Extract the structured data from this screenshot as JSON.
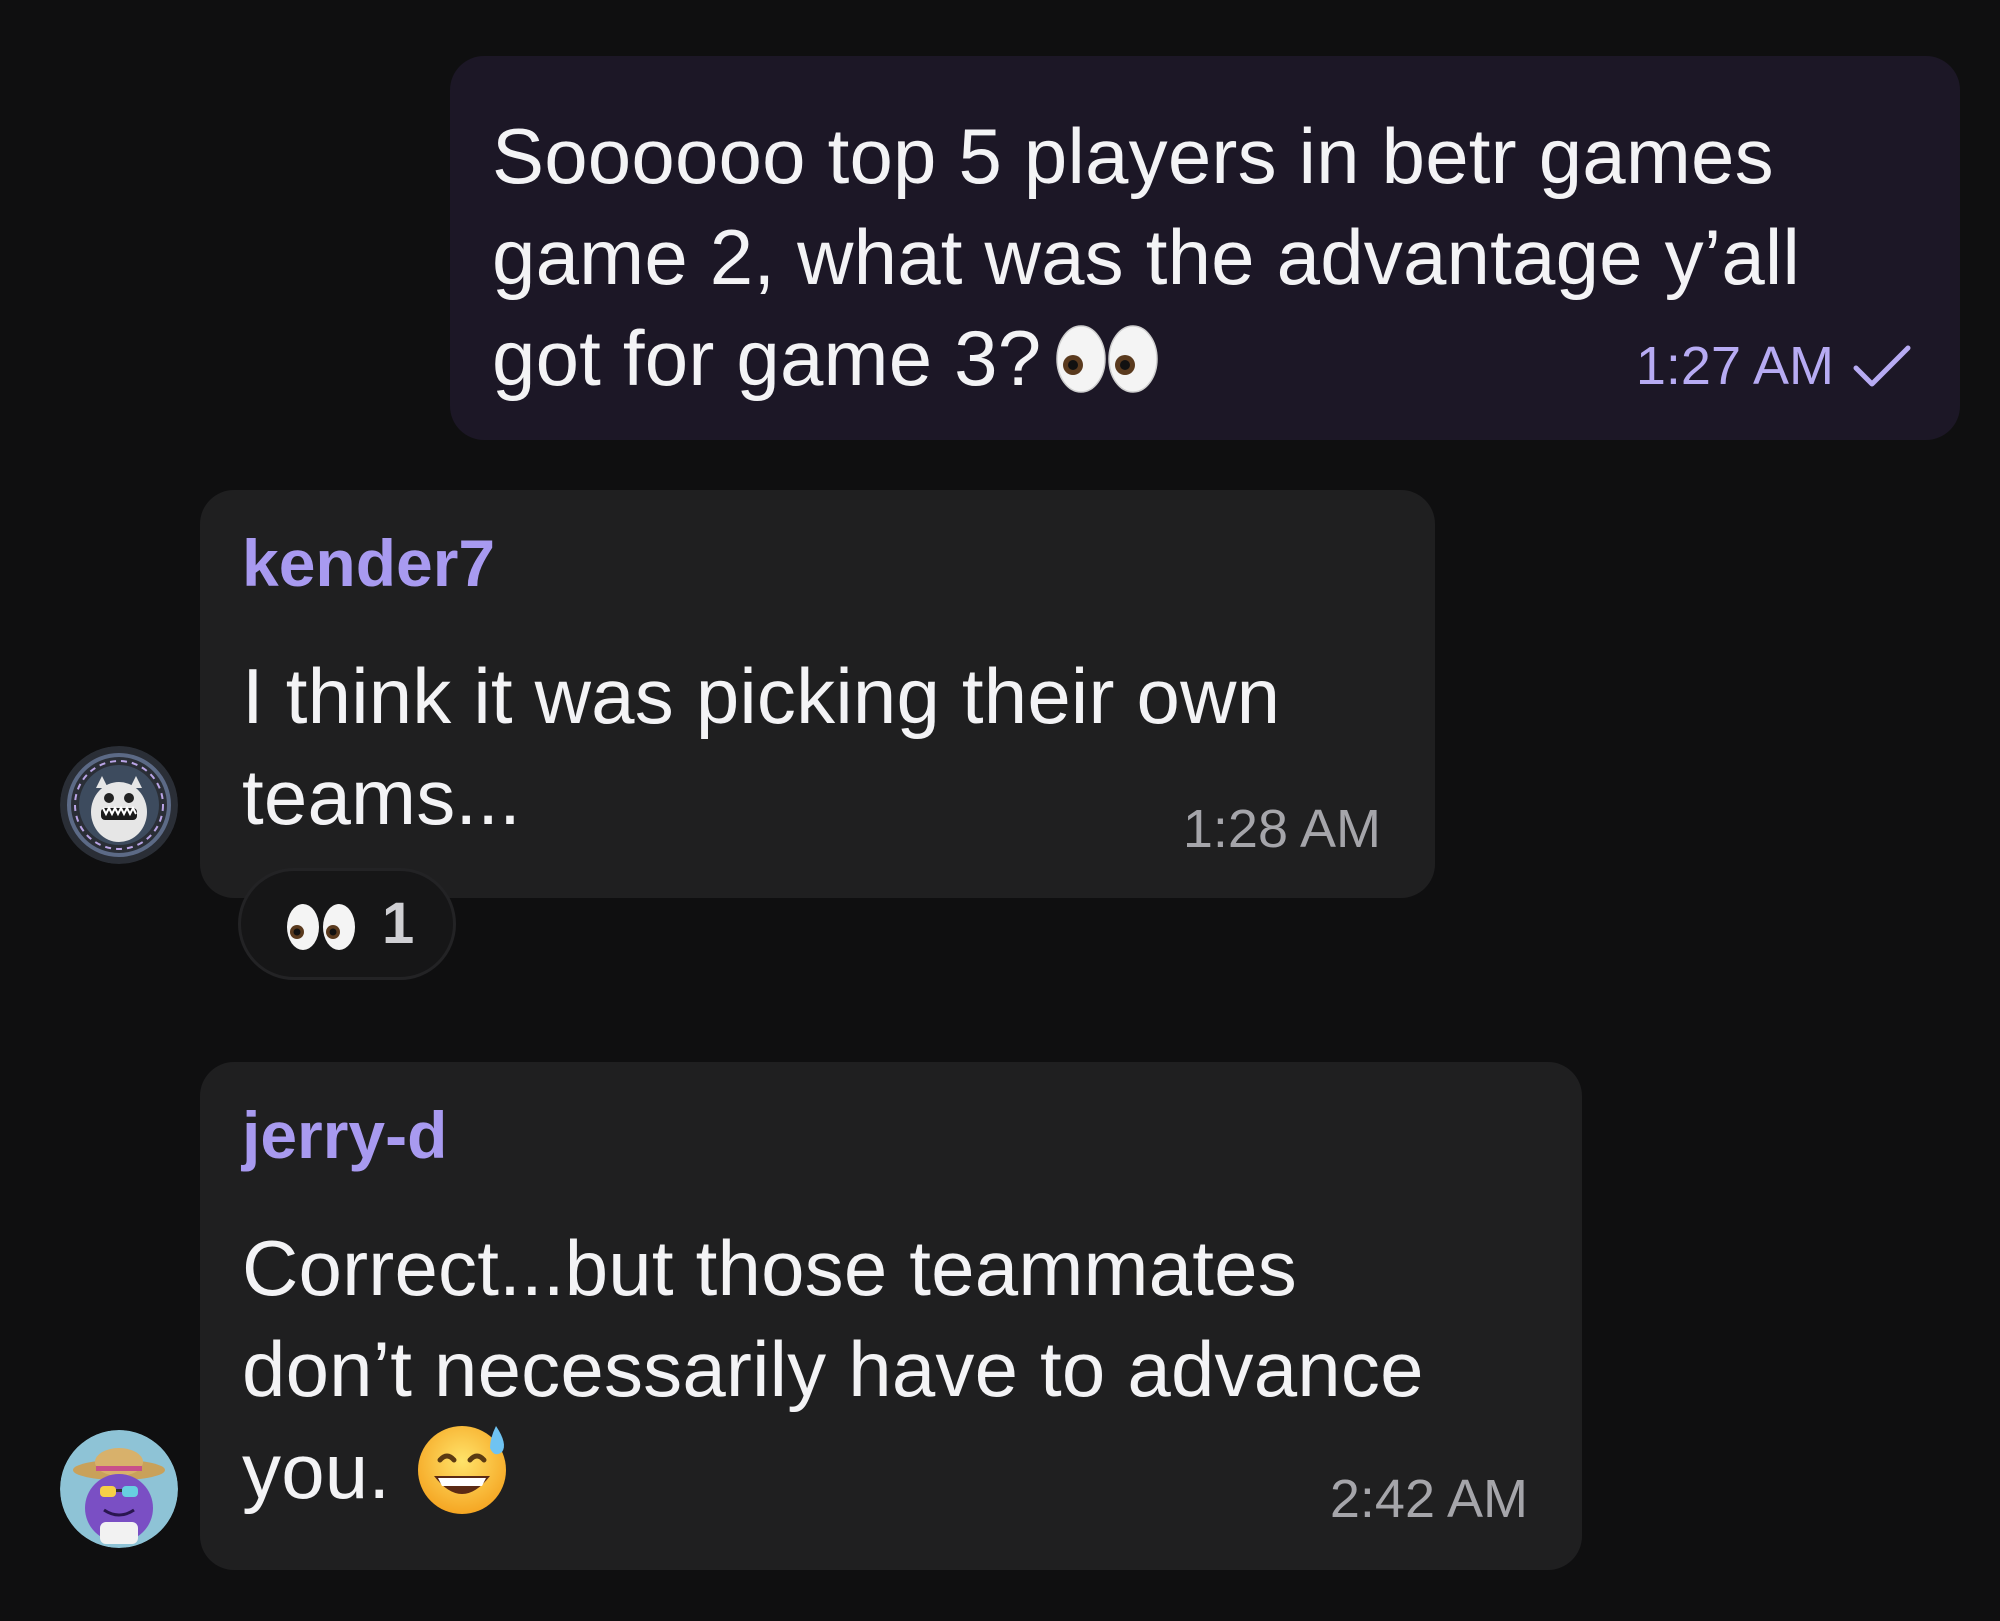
{
  "messages": [
    {
      "direction": "outgoing",
      "text": "Soooooo top 5 players in betr games\ngame 2, what was the advantage y’all\ngot for game 3?",
      "emoji": "eyes",
      "time": "1:27 AM",
      "status": "sent-check"
    },
    {
      "direction": "incoming",
      "sender": "kender7",
      "text": "I think it was picking their own\nteams...",
      "time": "1:28 AM",
      "avatar": "monster-avatar",
      "reaction": {
        "emoji": "eyes",
        "count": "1"
      }
    },
    {
      "direction": "incoming",
      "sender": "jerry-d",
      "text": "Correct...but those teammates\ndon’t necessarily have to advance\nyou.",
      "emoji": "grinning-sweat",
      "time": "2:42 AM",
      "avatar": "purple-creature-avatar"
    }
  ],
  "colors": {
    "background": "#0f0f10",
    "outgoing_bubble": "#1c1726",
    "incoming_bubble": "#1f1f20",
    "sender_name": "#a89af0",
    "outgoing_time": "#b7abf3",
    "incoming_time": "#a5a5aa"
  }
}
